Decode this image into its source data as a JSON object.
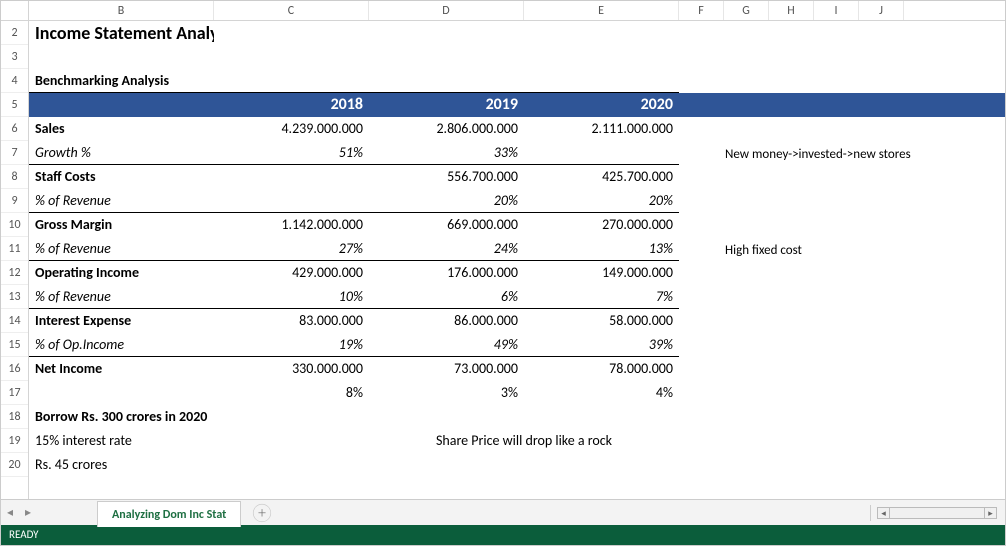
{
  "columns": [
    "A",
    "B",
    "C",
    "D",
    "E",
    "F",
    "G",
    "H",
    "I",
    "J"
  ],
  "col_widths": {
    "A": 28,
    "B": 185,
    "C": 155,
    "D": 155,
    "E": 155,
    "F": 45,
    "G": 45,
    "H": 45,
    "I": 45,
    "J": 45
  },
  "row_start": 2,
  "row_end": 20,
  "title": "Income Statement Analysis",
  "subtitle": "Benchmarking Analysis",
  "years": {
    "c": "2018",
    "d": "2019",
    "e": "2020"
  },
  "rows": {
    "sales": {
      "label": "Sales",
      "c": "4.239.000.000",
      "d": "2.806.000.000",
      "e": "2.111.000.000"
    },
    "growth": {
      "label": "Growth %",
      "c": "51%",
      "d": "33%",
      "e": ""
    },
    "staff": {
      "label": "Staff Costs",
      "c": "",
      "d": "556.700.000",
      "e": "425.700.000"
    },
    "staff_pct": {
      "label": "% of Revenue",
      "c": "",
      "d": "20%",
      "e": "20%"
    },
    "gross": {
      "label": "Gross Margin",
      "c": "1.142.000.000",
      "d": "669.000.000",
      "e": "270.000.000"
    },
    "gross_pct": {
      "label": "% of Revenue",
      "c": "27%",
      "d": "24%",
      "e": "13%"
    },
    "opinc": {
      "label": "Operating Income",
      "c": "429.000.000",
      "d": "176.000.000",
      "e": "149.000.000"
    },
    "opinc_pct": {
      "label": "% of Revenue",
      "c": "10%",
      "d": "6%",
      "e": "7%"
    },
    "intexp": {
      "label": "Interest Expense",
      "c": "83.000.000",
      "d": "86.000.000",
      "e": "58.000.000"
    },
    "intexp_pct": {
      "label": "% of Op.Income",
      "c": "19%",
      "d": "49%",
      "e": "39%"
    },
    "netinc": {
      "label": "Net Income",
      "c": "330.000.000",
      "d": "73.000.000",
      "e": "78.000.000"
    },
    "netinc_pct": {
      "label": "",
      "c": "8%",
      "d": "3%",
      "e": "4%"
    }
  },
  "footer": {
    "borrow": "Borrow Rs. 300 crores in 2020",
    "rate": "15% interest rate",
    "share_drop": "Share Price will drop like a rock",
    "amount": "Rs. 45 crores"
  },
  "notes": {
    "g7": "New money->invested->new stores",
    "g11": "High fixed cost"
  },
  "tabs": {
    "active": "Analyzing Dom Inc Stat"
  },
  "status": "READY"
}
